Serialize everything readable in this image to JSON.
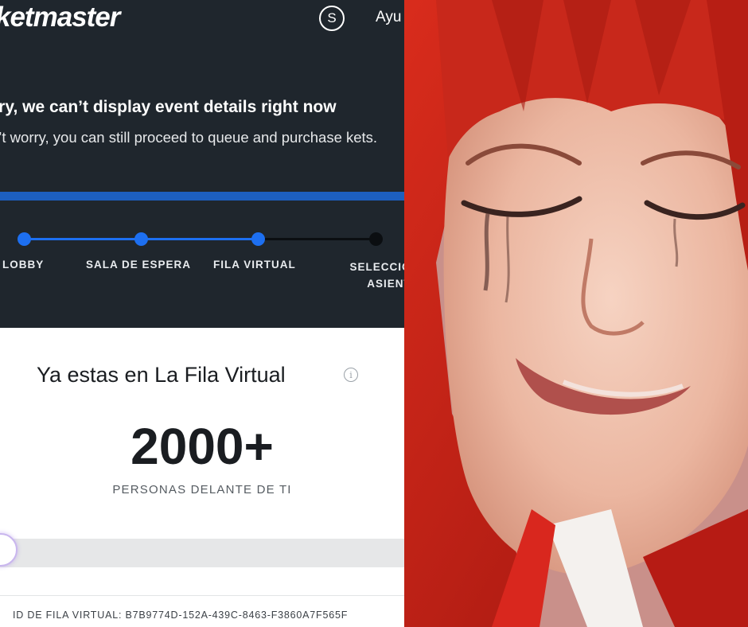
{
  "header": {
    "logo_text": "ketmaster",
    "account_initial": "S",
    "help_label": "Ayu"
  },
  "notice": {
    "title": "rry, we can’t display event details right now",
    "body": "n’t worry, you can still proceed to queue and purchase kets."
  },
  "steps": [
    {
      "label": "LOBBY",
      "status": "done"
    },
    {
      "label": "SALA DE ESPERA",
      "status": "done"
    },
    {
      "label": "FILA VIRTUAL",
      "status": "current"
    },
    {
      "label": "SELECCIONA ASIENTOS",
      "status": "upcoming"
    }
  ],
  "queue": {
    "title": "Ya estas en La Fila Virtual",
    "info_icon": "info-icon",
    "count": "2000+",
    "count_label": "PERSONAS DELANTE DE TI",
    "progress": 0.0,
    "id_text": "ID DE FILA VIRTUAL: B7B9774D-152A-439C-8463-F3860A7F565F"
  },
  "colors": {
    "dark_bg": "#1f262d",
    "accent_blue": "#1d6ff0",
    "hair_red": "#c3241a"
  }
}
